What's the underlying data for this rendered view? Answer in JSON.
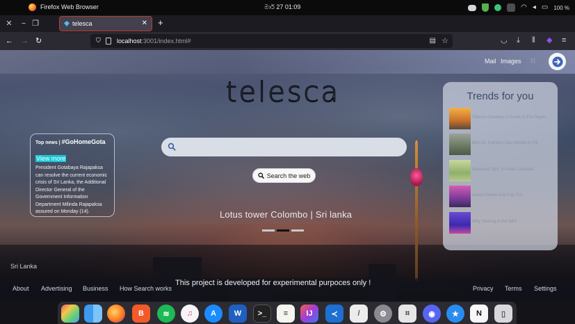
{
  "os": {
    "app_name": "Firefox Web Browser",
    "clock": "මාර් 27  01:09",
    "battery": "100 %"
  },
  "browser": {
    "tab_title": "telesca",
    "url_host": "localhost",
    "url_rest": ":3001/index.html#"
  },
  "page": {
    "top_links": {
      "mail": "Mail",
      "images": "Images"
    },
    "logo_text": "telesca",
    "news": {
      "label": "Top news | ",
      "tag": "#GoHomeGota",
      "view_more": "View more",
      "body": "President Gotabaya Rajapaksa can resolve the current economic crisis of Sri Lanka, the Additional Director General of the Government Information Department Milinda Rajapaksa assured on Monday (14)."
    },
    "search": {
      "placeholder": "",
      "button": "Search the web"
    },
    "caption": "Lotus tower Colombo | Sri lanka",
    "trends": {
      "title": "Trends for you",
      "items": [
        {
          "label": "Telesca Getaway: A Guide to Fort Myers"
        },
        {
          "label": "Best St. Patrick's Day Movies to Fill"
        },
        {
          "label": "Seasonal Sips: 5 Green Cocktails"
        },
        {
          "label": "Award Shows Aren't as Fun"
        },
        {
          "label": "Why Tanking in the NBA"
        }
      ]
    },
    "location": "Sri Lanka",
    "footer": {
      "about": "About",
      "advertising": "Advertising",
      "business": "Business",
      "how_search": "How Search works",
      "note": "This project is developed for experimental purpoces only !",
      "privacy": "Privacy",
      "terms": "Terms",
      "settings": "Settings"
    }
  },
  "colors": {
    "accent_view_more": "#18c6d8",
    "tab_border": "#c0392b",
    "trend_title": "#3d4a66"
  },
  "dock_apps": [
    "app-grid-icon",
    "finder-icon",
    "firefox-icon",
    "brave-icon",
    "spotify-icon",
    "music-icon",
    "app-store-icon",
    "word-icon",
    "terminal-icon",
    "notes-icon",
    "intellij-icon",
    "vscode-icon",
    "text-editor-icon",
    "settings-icon",
    "screenshot-icon",
    "discord-icon",
    "star-icon",
    "notion-icon",
    "trash-icon"
  ]
}
